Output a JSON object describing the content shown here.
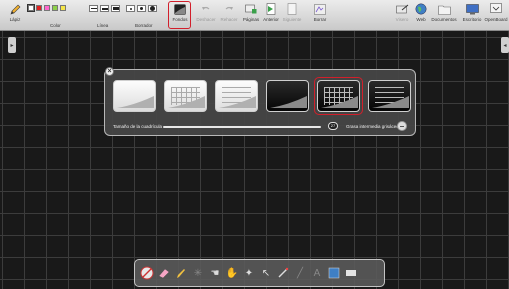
{
  "toolbar": {
    "items": [
      {
        "key": "lapiz",
        "label": "Lápiz",
        "icon": "pencil-icon"
      },
      {
        "key": "color",
        "label": "Color"
      },
      {
        "key": "linea",
        "label": "Línea"
      },
      {
        "key": "borrador",
        "label": "Borrador"
      },
      {
        "key": "fondos",
        "label": "Fondos",
        "icon": "background-icon",
        "selected": true
      },
      {
        "key": "deshacer",
        "label": "Deshacer",
        "icon": "undo-icon",
        "disabled": true
      },
      {
        "key": "rehacer",
        "label": "Rehacer",
        "icon": "redo-icon",
        "disabled": true
      },
      {
        "key": "paginas",
        "label": "Páginas",
        "icon": "pages-icon"
      },
      {
        "key": "anterior",
        "label": "Anterior",
        "icon": "previous-page-icon"
      },
      {
        "key": "siguiente",
        "label": "Siguiente",
        "icon": "next-page-icon",
        "disabled": true
      },
      {
        "key": "borrar",
        "label": "Borrar",
        "icon": "erase-page-icon"
      },
      {
        "key": "visero",
        "label": "Visero",
        "icon": "visualizer-icon"
      },
      {
        "key": "web",
        "label": "Web",
        "icon": "globe-icon"
      },
      {
        "key": "documentos",
        "label": "Documentos",
        "icon": "folder-icon"
      },
      {
        "key": "escritorio",
        "label": "Escritorio",
        "icon": "desktop-icon"
      },
      {
        "key": "openboard",
        "label": "OpenBoard",
        "icon": "openboard-icon"
      }
    ],
    "colors": [
      "#ffffff",
      "#e02020",
      "#ff66cc",
      "#8ed04a",
      "#f5e64a"
    ]
  },
  "palette": {
    "backgrounds": [
      {
        "name": "light-plain",
        "theme": "light",
        "grid": "none"
      },
      {
        "name": "light-grid",
        "theme": "light",
        "grid": "squares"
      },
      {
        "name": "light-lines",
        "theme": "light",
        "grid": "lines"
      },
      {
        "name": "dark-plain",
        "theme": "dark",
        "grid": "none"
      },
      {
        "name": "dark-grid",
        "theme": "dark",
        "grid": "squares",
        "selected": true
      },
      {
        "name": "dark-lines",
        "theme": "dark",
        "grid": "lines"
      }
    ],
    "grid_size_label": "Tamaño de la cuadrícula",
    "grid_size_value": "27",
    "intermediate_label": "Grasa intermedia grisáceo"
  },
  "dock": {
    "tools": [
      "stop-icon",
      "eraser-icon",
      "pen-icon",
      "laser-pointer-icon",
      "hand-icon",
      "hand-grab-icon",
      "magic-wand-icon",
      "pointer-icon",
      "marker-icon",
      "line-icon",
      "text-icon",
      "capture-icon",
      "shape-icon"
    ]
  },
  "accent": "#d21f2b"
}
